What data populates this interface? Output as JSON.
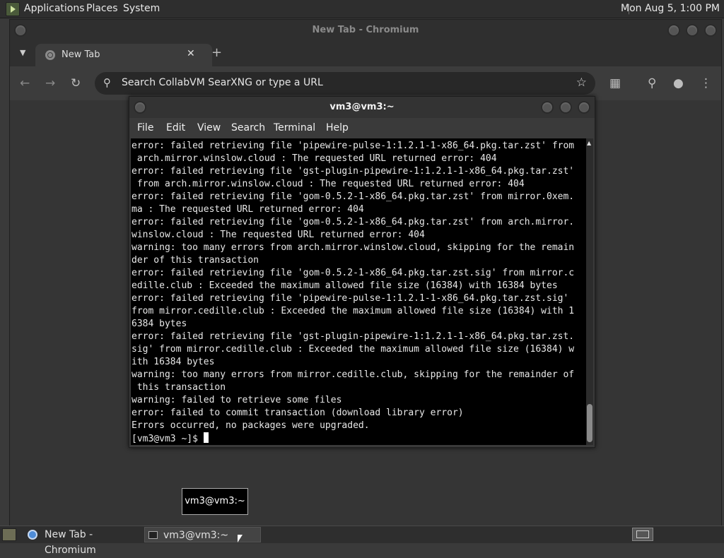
{
  "top_panel": {
    "menus": [
      "Applications",
      "Places",
      "System"
    ],
    "clock": "Mon Aug  5,  1:00 PM"
  },
  "chrome": {
    "window_title": "New Tab - Chromium",
    "tab_title": "New Tab",
    "tab_close": "✕",
    "new_tab": "+",
    "omnibox_text": "Search CollabVM SearXNG or type a URL",
    "icons": [
      "back-icon",
      "forward-icon",
      "reload-icon",
      "search-icon",
      "star-icon",
      "extensions-icon",
      "labs-icon",
      "profile-icon",
      "menu-icon"
    ]
  },
  "terminal": {
    "title": "vm3@vm3:~",
    "menu": [
      "File",
      "Edit",
      "View",
      "Search",
      "Terminal",
      "Help"
    ],
    "lines": [
      "error: failed retrieving file 'pipewire-pulse-1:1.2.1-1-x86_64.pkg.tar.zst' from",
      " arch.mirror.winslow.cloud : The requested URL returned error: 404",
      "error: failed retrieving file 'gst-plugin-pipewire-1:1.2.1-1-x86_64.pkg.tar.zst'",
      " from arch.mirror.winslow.cloud : The requested URL returned error: 404",
      "error: failed retrieving file 'gom-0.5.2-1-x86_64.pkg.tar.zst' from mirror.0xem.",
      "ma : The requested URL returned error: 404",
      "error: failed retrieving file 'gom-0.5.2-1-x86_64.pkg.tar.zst' from arch.mirror.",
      "winslow.cloud : The requested URL returned error: 404",
      "warning: too many errors from arch.mirror.winslow.cloud, skipping for the remain",
      "der of this transaction",
      "error: failed retrieving file 'gom-0.5.2-1-x86_64.pkg.tar.zst.sig' from mirror.c",
      "edille.club : Exceeded the maximum allowed file size (16384) with 16384 bytes",
      "error: failed retrieving file 'pipewire-pulse-1:1.2.1-1-x86_64.pkg.tar.zst.sig'",
      "from mirror.cedille.club : Exceeded the maximum allowed file size (16384) with 1",
      "6384 bytes",
      "error: failed retrieving file 'gst-plugin-pipewire-1:1.2.1-1-x86_64.pkg.tar.zst.",
      "sig' from mirror.cedille.club : Exceeded the maximum allowed file size (16384) w",
      "ith 16384 bytes",
      "warning: too many errors from mirror.cedille.club, skipping for the remainder of",
      " this transaction",
      "warning: failed to retrieve some files",
      "error: failed to commit transaction (download library error)",
      "Errors occurred, no packages were upgraded."
    ],
    "prompt": "[vm3@vm3 ~]$ "
  },
  "tooltip": "vm3@vm3:~",
  "taskbar": {
    "tasks": [
      "New Tab - Chromium",
      "vm3@vm3:~"
    ]
  }
}
